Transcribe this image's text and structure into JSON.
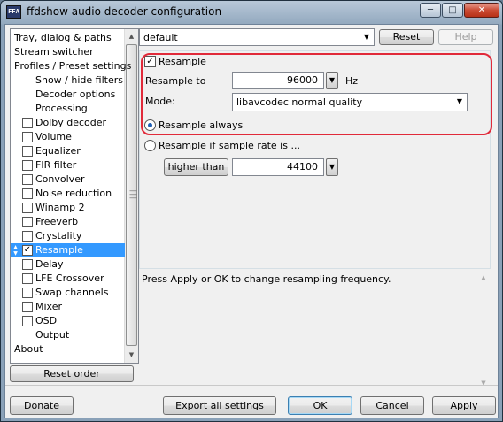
{
  "window": {
    "title": "ffdshow audio decoder configuration",
    "app_icon_text": "FFA",
    "minimize_glyph": "─",
    "maximize_glyph": "□",
    "close_glyph": "✕"
  },
  "tree": {
    "items": [
      {
        "label": "Tray, dialog & paths",
        "checkbox": false,
        "indent": 0
      },
      {
        "label": "Stream switcher",
        "checkbox": false,
        "indent": 0
      },
      {
        "label": "Profiles / Preset settings",
        "checkbox": false,
        "indent": 0
      },
      {
        "label": "Show / hide filters",
        "checkbox": false,
        "indent": 2
      },
      {
        "label": "Decoder options",
        "checkbox": false,
        "indent": 2
      },
      {
        "label": "Processing",
        "checkbox": false,
        "indent": 2
      },
      {
        "label": "Dolby decoder",
        "checkbox": true,
        "checked": false,
        "indent": 1
      },
      {
        "label": "Volume",
        "checkbox": true,
        "checked": false,
        "indent": 1
      },
      {
        "label": "Equalizer",
        "checkbox": true,
        "checked": false,
        "indent": 1
      },
      {
        "label": "FIR filter",
        "checkbox": true,
        "checked": false,
        "indent": 1
      },
      {
        "label": "Convolver",
        "checkbox": true,
        "checked": false,
        "indent": 1
      },
      {
        "label": "Noise reduction",
        "checkbox": true,
        "checked": false,
        "indent": 1
      },
      {
        "label": "Winamp 2",
        "checkbox": true,
        "checked": false,
        "indent": 1
      },
      {
        "label": "Freeverb",
        "checkbox": true,
        "checked": false,
        "indent": 1
      },
      {
        "label": "Crystality",
        "checkbox": true,
        "checked": false,
        "indent": 1
      },
      {
        "label": "Resample",
        "checkbox": true,
        "checked": true,
        "selected": true,
        "indent": 1
      },
      {
        "label": "Delay",
        "checkbox": true,
        "checked": false,
        "indent": 1
      },
      {
        "label": "LFE Crossover",
        "checkbox": true,
        "checked": false,
        "indent": 1
      },
      {
        "label": "Swap channels",
        "checkbox": true,
        "checked": false,
        "indent": 1
      },
      {
        "label": "Mixer",
        "checkbox": true,
        "checked": false,
        "indent": 1
      },
      {
        "label": "OSD",
        "checkbox": true,
        "checked": false,
        "indent": 1
      },
      {
        "label": "Output",
        "checkbox": false,
        "indent": 2
      },
      {
        "label": "About",
        "checkbox": false,
        "indent": 0
      }
    ]
  },
  "buttons": {
    "reset_order": "Reset order",
    "reset": "Reset",
    "help": "Help",
    "donate": "Donate",
    "export_all": "Export all settings",
    "ok": "OK",
    "cancel": "Cancel",
    "apply": "Apply",
    "higher_than": "higher than"
  },
  "preset": {
    "value": "default"
  },
  "resample": {
    "enable_label": "Resample",
    "enabled": true,
    "resample_to_label": "Resample to",
    "resample_to_value": "96000",
    "unit": "Hz",
    "mode_label": "Mode:",
    "mode_value": "libavcodec normal quality",
    "always_label": "Resample always",
    "always_selected": true,
    "if_rate_label": "Resample if sample rate is ...",
    "if_rate_selected": false,
    "threshold_value": "44100"
  },
  "info": {
    "text": "Press Apply or OK to change resampling frequency."
  },
  "icons": {
    "check": "✓",
    "dropdown": "▼",
    "scroll_up": "▲",
    "scroll_down": "▼",
    "spin_up": "▲",
    "spin_down": "▼"
  },
  "colors": {
    "highlight_border": "#e12a3a",
    "selection": "#3399ff",
    "close_button": "#cb4b34"
  }
}
